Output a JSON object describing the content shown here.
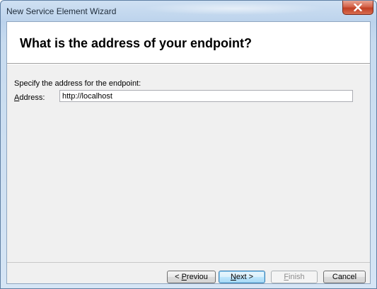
{
  "window": {
    "title": "New Service Element Wizard"
  },
  "header": {
    "title": "What is the address of your endpoint?"
  },
  "body": {
    "instruction": "Specify the address for the endpoint:",
    "address_label_mnemonic": "A",
    "address_label_rest": "ddress:",
    "address_value": "http://localhost"
  },
  "buttons": {
    "previous_prefix": "< ",
    "previous_mnemonic": "P",
    "previous_rest": "reviou",
    "next_mnemonic": "N",
    "next_rest": "ext >",
    "finish_mnemonic": "F",
    "finish_rest": "inish",
    "cancel_label": "Cancel"
  },
  "icons": {
    "close": "close-icon"
  },
  "colors": {
    "close_button": "#c13f24",
    "default_button_border": "#3c7fb1",
    "window_frame": "#bcd3ec"
  }
}
